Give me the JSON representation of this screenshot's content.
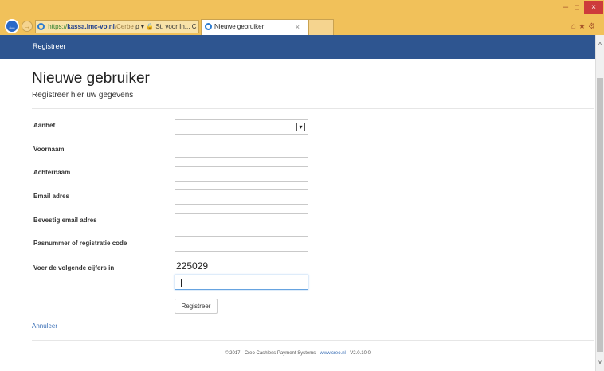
{
  "browser": {
    "url_protocol": "https://",
    "url_host": "kassa.lmc-vo.nl",
    "url_rest": "/Cerbe",
    "search_glyph": "ρ",
    "dropdown_glyph": "▾",
    "site_label": "St. voor In...",
    "refresh_glyph": "C",
    "tab_title": "Nieuwe gebruiker",
    "tab_close": "×",
    "back_glyph": "←",
    "forward_glyph": "→",
    "minimize_glyph": "–",
    "maximize_glyph": "□",
    "close_glyph": "×",
    "toolbar_glyphs": "⌂★⚙"
  },
  "navbar": {
    "brand": "Registreer"
  },
  "page": {
    "title": "Nieuwe gebruiker",
    "subtitle": "Registreer hier uw gegevens"
  },
  "form": {
    "fields": {
      "aanhef": {
        "label": "Aanhef",
        "value": ""
      },
      "voornaam": {
        "label": "Voornaam",
        "value": ""
      },
      "achternaam": {
        "label": "Achternaam",
        "value": ""
      },
      "email": {
        "label": "Email adres",
        "value": ""
      },
      "email_confirm": {
        "label": "Bevestig email adres",
        "value": ""
      },
      "pasnummer": {
        "label": "Pasnummer of registratie code",
        "value": ""
      },
      "captcha": {
        "label": "Voer de volgende cijfers in",
        "code": "225029",
        "value": ""
      }
    },
    "select_arrow": "▾",
    "submit_label": "Registreer",
    "cancel_label": "Annuleer"
  },
  "footer": {
    "text": "© 2017 - Creo Cashless Payment Systems - ",
    "link": "www.creo.nl",
    "version": " - V2.0.10.0"
  },
  "scrollbar": {
    "up_glyph": "^",
    "down_glyph": "v"
  },
  "colors": {
    "navbar": "#2e5590",
    "chrome": "#f1c15a",
    "link": "#3a6fb6"
  }
}
